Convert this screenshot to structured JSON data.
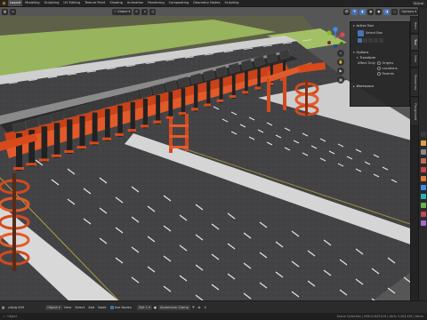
{
  "topbar": {
    "workspaces": [
      "Layout",
      "Modeling",
      "Sculpting",
      "UV Editing",
      "Texture Paint",
      "Shading",
      "Animation",
      "Rendering",
      "Compositing",
      "Geometry Nodes",
      "Scripting"
    ],
    "active_index": 0,
    "scene_label": "Scene"
  },
  "header": {
    "mode": "Global",
    "options_label": "Options"
  },
  "npanel": {
    "active_tool_title": "Active Tool",
    "tool_name": "Select Box",
    "options_title": "Options",
    "transform_title": "Transform",
    "affect_only_label": "Affect Only",
    "affect_options": [
      "Origins",
      "Locations",
      "Parents"
    ],
    "workspace_title": "Workspace"
  },
  "sidebar_tabs": [
    "Item",
    "Tool",
    "View",
    "Resources",
    "Playground"
  ],
  "active_tab": 1,
  "bottombar": {
    "playback": "Playback",
    "file_label": "pfjzig 009",
    "object_mode": "Object",
    "menus": [
      "View",
      "Select",
      "Add",
      "Node"
    ],
    "use_nodes": "Use Nodes",
    "slot": "Slot 1",
    "material": "Aluminium Clamp"
  },
  "statusbar": {
    "left": "Object",
    "right": "Scene Collection | K96.G-MAT.019 | Verts 3,203,438 | Faces"
  },
  "colors": {
    "grass": "#98b45c",
    "road": "#444447",
    "structure_orange": "#d84a1c",
    "solar_panel": "#2a2a2a",
    "accent": "#4772b3"
  }
}
